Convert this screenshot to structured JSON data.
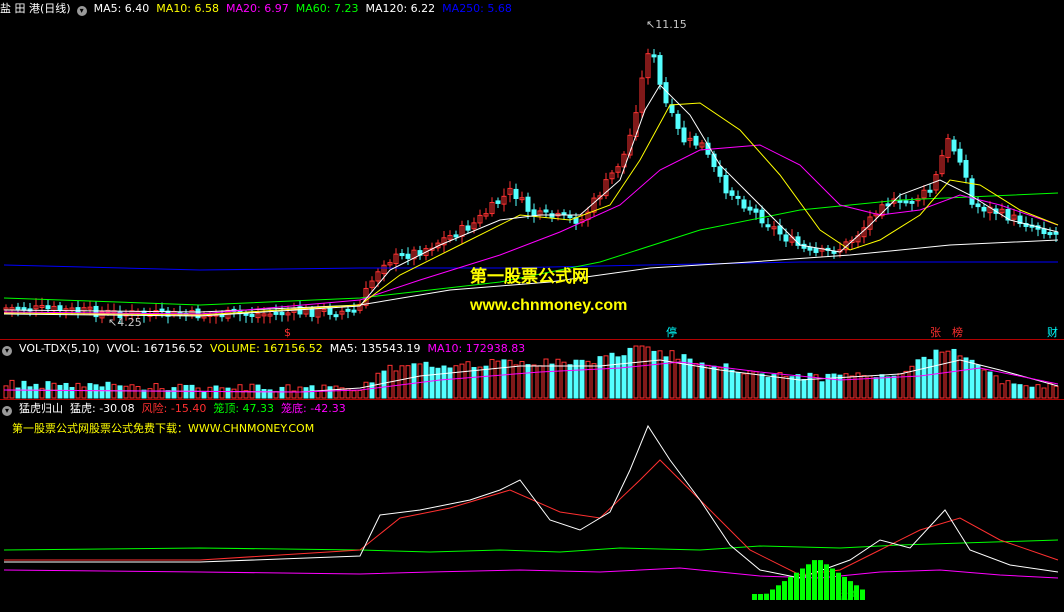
{
  "main_header": {
    "stock_name": "盐 田 港(日线)",
    "items": [
      {
        "text": "MA5: 6.40",
        "color": "#ffffff"
      },
      {
        "text": "MA10: 6.58",
        "color": "#ffff00"
      },
      {
        "text": "MA20: 6.97",
        "color": "#ff00ff"
      },
      {
        "text": "MA60: 7.23",
        "color": "#00ff00"
      },
      {
        "text": "MA120: 6.22",
        "color": "#ffffff"
      },
      {
        "text": "MA250: 5.68",
        "color": "#0000ff"
      }
    ]
  },
  "price_chart": {
    "high_label": "11.15",
    "low_label": "4.25",
    "markers": [
      {
        "text": "$",
        "color": "#ff3030"
      },
      {
        "text": "停",
        "color": "#00ffff"
      },
      {
        "text": "张",
        "color": "#ff3030"
      },
      {
        "text": "榜",
        "color": "#ff3030"
      },
      {
        "text": "财",
        "color": "#00ffff"
      }
    ]
  },
  "watermark": {
    "line1": "第一股票公式网",
    "line2": "www.chnmoney.com"
  },
  "volume_header": {
    "name": "VOL-TDX(5,10)",
    "items": [
      {
        "text": "VVOL: 167156.52",
        "color": "#ffffff"
      },
      {
        "text": "VOLUME: 167156.52",
        "color": "#ffff00"
      },
      {
        "text": "MA5: 135543.19",
        "color": "#ffffff"
      },
      {
        "text": "MA10: 172938.83",
        "color": "#ff00ff"
      }
    ]
  },
  "indicator_header": {
    "name": "猛虎归山",
    "items": [
      {
        "text": "猛虎: -30.08",
        "color": "#ffffff"
      },
      {
        "text": "风险: -15.40",
        "color": "#ff3030"
      },
      {
        "text": "笼顶: 47.33",
        "color": "#00ff00"
      },
      {
        "text": "笼底: -42.33",
        "color": "#ff00ff"
      }
    ],
    "note": "第一股票公式网股票公式免费下载：WWW.CHNMONEY.COM",
    "bar_label": "猛虎"
  },
  "colors": {
    "up": "#ff3232",
    "down": "#54ffff",
    "ma5": "#ffffff",
    "ma10": "#ffff00",
    "ma20": "#ff00ff",
    "ma60": "#00ff00",
    "ma120": "#ffffff",
    "ma250": "#0000ff",
    "border": "#b00000",
    "tiger_bar": "#00ff00"
  }
}
